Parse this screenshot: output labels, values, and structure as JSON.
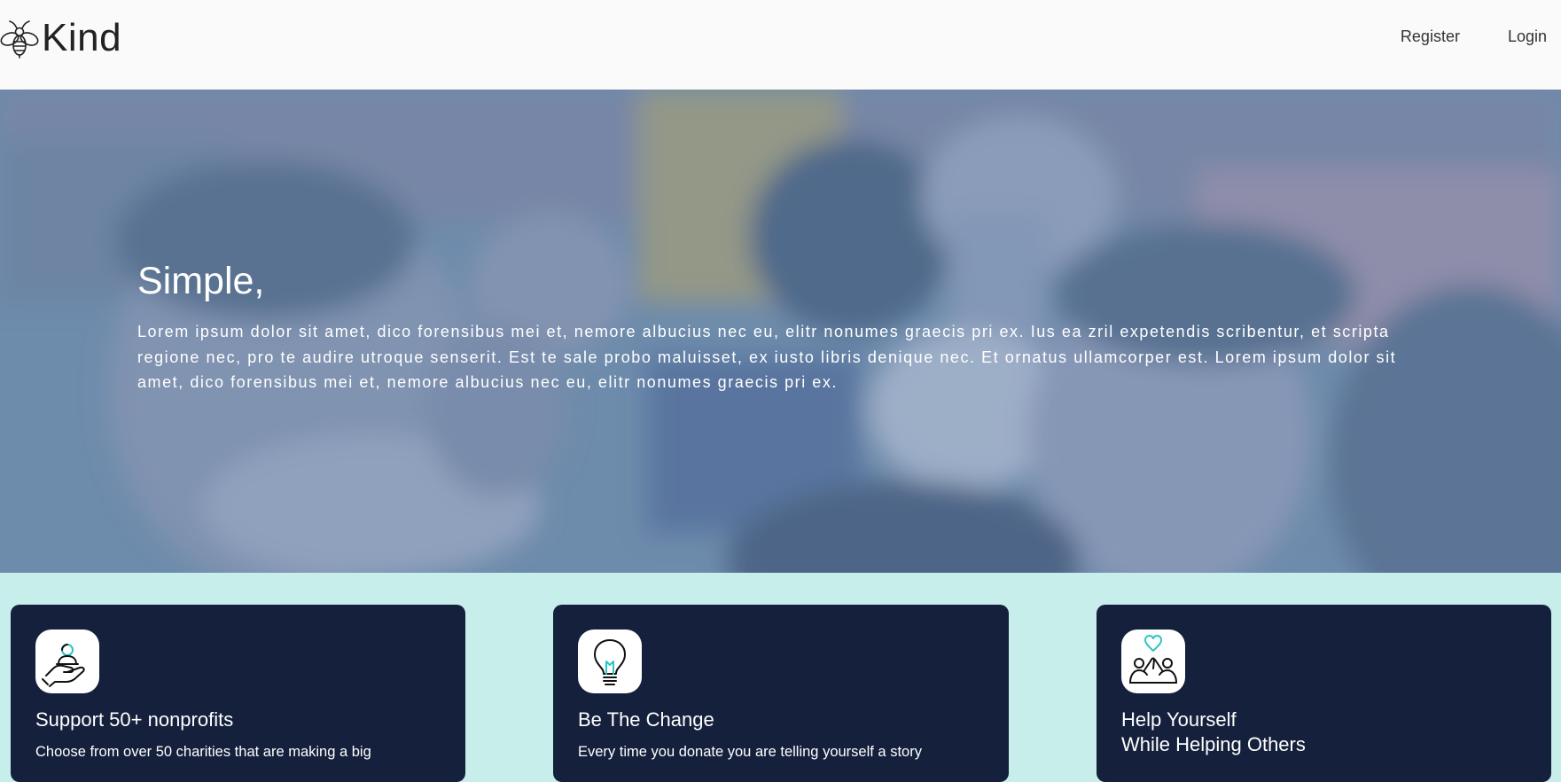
{
  "header": {
    "brand_name": "Kind",
    "brand_icon": "bee-icon",
    "nav": [
      {
        "label": "Register"
      },
      {
        "label": "Login"
      }
    ]
  },
  "hero": {
    "title": "Simple,",
    "text": "Lorem ipsum dolor sit amet, dico forensibus mei et, nemore albucius nec eu, elitr nonumes graecis pri ex. Ius ea zril expetendis scribentur, et scripta regione nec, pro te audire utroque senserit. Est te sale probo maluisset, ex iusto libris denique nec. Et ornatus ullamcorper est. Lorem ipsum dolor sit amet, dico forensibus mei et, nemore albucius nec eu, elitr nonumes graecis pri ex."
  },
  "cards": [
    {
      "icon": "hand-giving-icon",
      "title_lines": [
        "Support 50+ nonprofits"
      ],
      "text": "Choose from over 50 charities that are making a big"
    },
    {
      "icon": "lightbulb-icon",
      "title_lines": [
        "Be The Change"
      ],
      "text": "Every time you donate you are telling yourself a story"
    },
    {
      "icon": "helping-hands-heart-icon",
      "title_lines": [
        "Help Yourself",
        "While Helping Others"
      ],
      "text": ""
    }
  ],
  "colors": {
    "header_bg": "#fafafa",
    "page_bg": "#c8eeec",
    "card_bg": "#14203c",
    "accent_teal": "#2ec4c4",
    "hero_tint": "#6f8aa6"
  }
}
